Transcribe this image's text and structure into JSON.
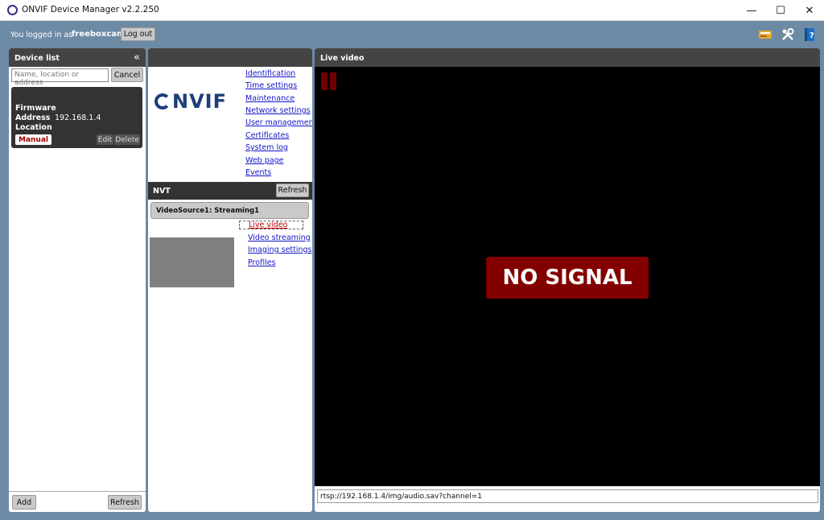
{
  "window": {
    "title": "ONVIF Device Manager v2.2.250",
    "minimize_glyph": "—",
    "maximize_glyph": "☐",
    "close_glyph": "✕"
  },
  "topbar": {
    "logged_in_text": "You logged in as",
    "username": "freeboxcam",
    "logout_label": "Log out",
    "icons": [
      "network-icon",
      "tools-icon",
      "help-book-icon"
    ]
  },
  "device_list": {
    "header": "Device list",
    "collapse_glyph": "«",
    "search_placeholder": "Name, location or address",
    "cancel_label": "Cancel",
    "devices": [
      {
        "firmware_label": "Firmware",
        "address_label": "Address",
        "address": "192.168.1.4",
        "location_label": "Location",
        "badge": "Manual",
        "edit_label": "Edit",
        "delete_label": "Delete"
      }
    ],
    "add_label": "Add",
    "refresh_label": "Refresh"
  },
  "device_panel": {
    "logo_text": "NVIF",
    "links": [
      "Identification",
      "Time settings",
      "Maintenance",
      "Network settings",
      "User management",
      "Certificates",
      "System log",
      "Web page",
      "Events"
    ],
    "nvt_label": "NVT",
    "refresh_label": "Refresh",
    "video_source": "VideoSource1: Streaming1",
    "live_video_link": "Live video",
    "stream_links": [
      "Video streaming",
      "Imaging settings",
      "Profiles"
    ]
  },
  "live_video": {
    "header": "Live video",
    "no_signal": "NO SIGNAL",
    "url": "rtsp://192.168.1.4/img/audio.sav?channel=1"
  }
}
